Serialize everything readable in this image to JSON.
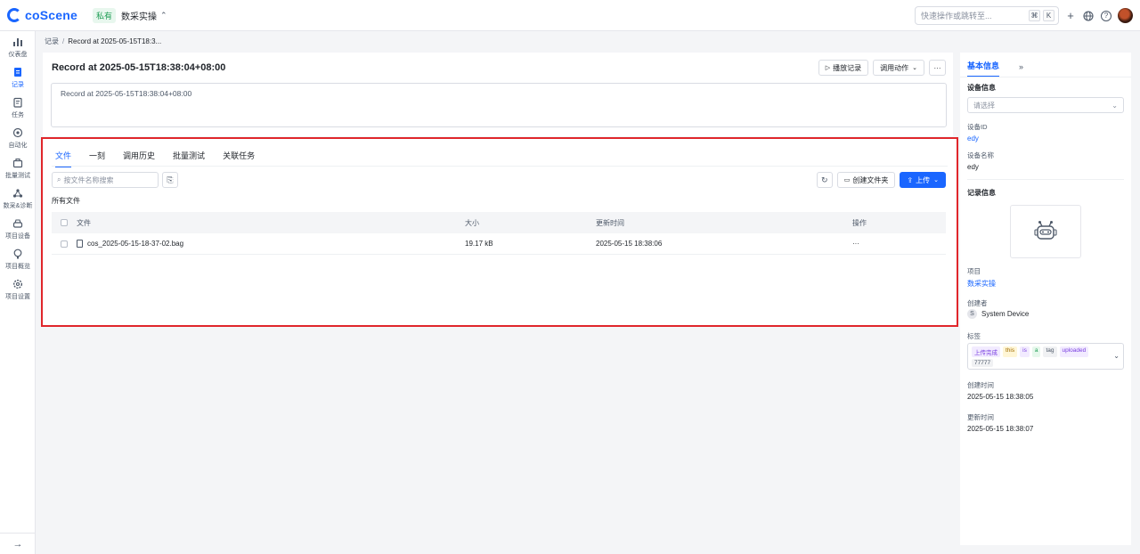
{
  "topbar": {
    "logo_text": "coScene",
    "project_badge": "私有",
    "project_name": "数采实操",
    "search_placeholder": "快速操作或跳转至...",
    "shortcut_mod": "⌘",
    "shortcut_key": "K"
  },
  "leftnav": {
    "items": [
      {
        "label": "仪表盘",
        "icon": "dashboard-icon"
      },
      {
        "label": "记录",
        "icon": "records-icon"
      },
      {
        "label": "任务",
        "icon": "tasks-icon"
      },
      {
        "label": "自动化",
        "icon": "automation-icon"
      },
      {
        "label": "批量测试",
        "icon": "batch-test-icon"
      },
      {
        "label": "数采&诊断",
        "icon": "data-diagnosis-icon"
      },
      {
        "label": "项目设备",
        "icon": "project-device-icon"
      },
      {
        "label": "项目概览",
        "icon": "project-overview-icon"
      },
      {
        "label": "项目设置",
        "icon": "project-settings-icon"
      }
    ],
    "active": "记录"
  },
  "breadcrumb": {
    "root": "记录",
    "current": "Record at 2025-05-15T18:3..."
  },
  "record": {
    "title": "Record at 2025-05-15T18:38:04+08:00",
    "description": "Record at 2025-05-15T18:38:04+08:00",
    "play_label": "播放记录",
    "action_label": "调用动作",
    "more_label": "···"
  },
  "files": {
    "tabs": [
      "文件",
      "一刻",
      "调用历史",
      "批量测试",
      "关联任务"
    ],
    "active_tab": "文件",
    "search_placeholder": "按文件名称搜索",
    "create_folder_label": "创建文件夹",
    "upload_label": "上传",
    "section_title": "所有文件",
    "columns": {
      "name": "文件",
      "size": "大小",
      "updated": "更新时间",
      "ops": "操作"
    },
    "rows": [
      {
        "name": "cos_2025-05-15-18-37-02.bag",
        "size": "19.17 kB",
        "updated": "2025-05-15 18:38:06",
        "ops": "···"
      }
    ]
  },
  "panel": {
    "tab_label": "基本信息",
    "expand_label": "»",
    "device_section": "设备信息",
    "device_select_placeholder": "请选择",
    "device_id_label": "设备ID",
    "device_id": "edy",
    "device_name_label": "设备名称",
    "device_name": "edy",
    "record_section": "记录信息",
    "project_label": "项目",
    "project": "数采实操",
    "creator_label": "创建者",
    "creator_initial": "S",
    "creator": "System Device",
    "tags_label": "标签",
    "tags": [
      {
        "text": "上传完成",
        "style": "purple"
      },
      {
        "text": "this",
        "style": "yellow"
      },
      {
        "text": "is",
        "style": "purple"
      },
      {
        "text": "a",
        "style": "green"
      },
      {
        "text": "tag",
        "style": "gray"
      },
      {
        "text": "uploaded",
        "style": "purple"
      },
      {
        "text": "77777",
        "style": "gray"
      }
    ],
    "created_label": "创建时间",
    "created": "2025-05-15 18:38:05",
    "updated_label": "更新时间",
    "updated": "2025-05-15 18:38:07"
  }
}
